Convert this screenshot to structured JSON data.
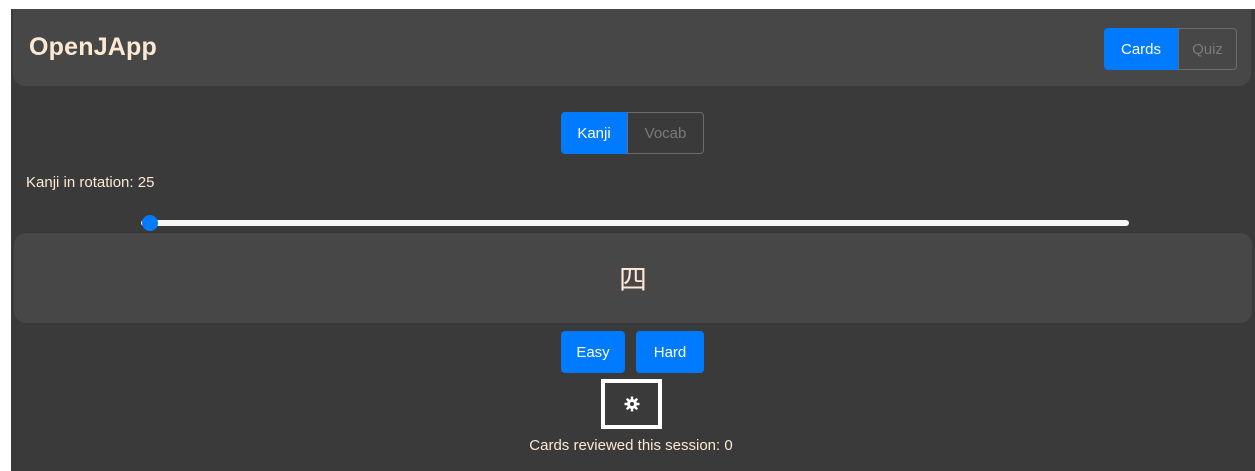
{
  "header": {
    "brand": "OpenJApp",
    "mode_tabs": [
      {
        "label": "Cards",
        "active": true
      },
      {
        "label": "Quiz",
        "active": false
      }
    ]
  },
  "type_tabs": [
    {
      "label": "Kanji",
      "active": true
    },
    {
      "label": "Vocab",
      "active": false
    }
  ],
  "rotation": {
    "label": "Kanji in rotation: 25",
    "slider_value": 25
  },
  "card": {
    "character": "四"
  },
  "actions": {
    "easy_label": "Easy",
    "hard_label": "Hard"
  },
  "settings": {
    "icon": "gear-icon"
  },
  "session": {
    "label": "Cards reviewed this session: 0"
  },
  "colors": {
    "accent": "#007bff",
    "background": "#3a3a3a",
    "panel": "#474747",
    "text": "#fde8d3"
  }
}
